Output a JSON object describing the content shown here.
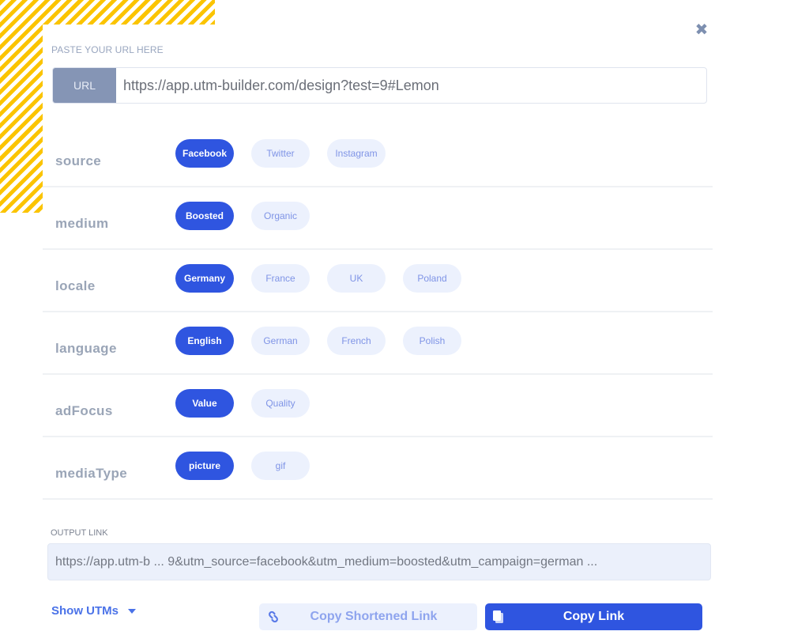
{
  "header": {
    "paste_label": "PASTE YOUR URL HERE",
    "url_tag": "URL",
    "url_value": "https://app.utm-builder.com/design?test=9#Lemon",
    "close_icon": "close-icon"
  },
  "params": [
    {
      "label": "source",
      "options": [
        "Facebook",
        "Twitter",
        "Instagram"
      ],
      "selected": "Facebook"
    },
    {
      "label": "medium",
      "options": [
        "Boosted",
        "Organic"
      ],
      "selected": "Boosted"
    },
    {
      "label": "locale",
      "options": [
        "Germany",
        "France",
        "UK",
        "Poland"
      ],
      "selected": "Germany"
    },
    {
      "label": "language",
      "options": [
        "English",
        "German",
        "French",
        "Polish"
      ],
      "selected": "English"
    },
    {
      "label": "adFocus",
      "options": [
        "Value",
        "Quality"
      ],
      "selected": "Value"
    },
    {
      "label": "mediaType",
      "options": [
        "picture",
        "gif"
      ],
      "selected": "picture"
    }
  ],
  "output": {
    "label": "OUTPUT LINK",
    "value": "https://app.utm-b ... 9&utm_source=facebook&utm_medium=boosted&utm_campaign=german ..."
  },
  "footer": {
    "show_utms": "Show UTMs",
    "copy_shortened": "Copy Shortened Link",
    "copy_link": "Copy Link"
  },
  "colors": {
    "accent": "#2f55e0",
    "chip_inactive_bg": "#ecf1fd",
    "stripe": "#fbc400"
  }
}
